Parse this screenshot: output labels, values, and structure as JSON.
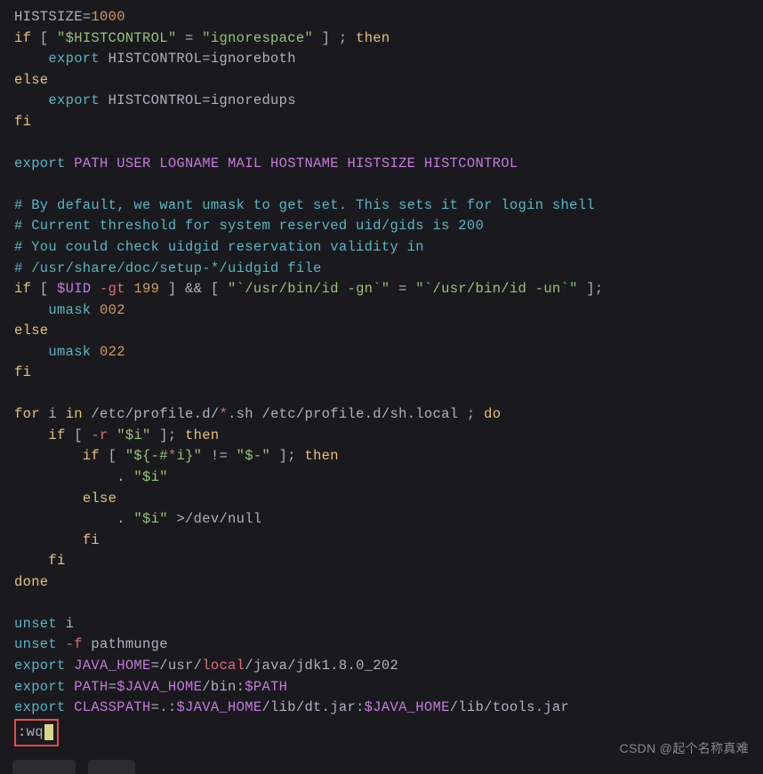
{
  "code": {
    "line1_var": "HISTSIZE",
    "line1_eq": "=",
    "line1_val": "1000",
    "line2_if": "if",
    "line2_br1": " [ ",
    "line2_str1": "\"$HISTCONTROL\"",
    "line2_eq": " = ",
    "line2_str2": "\"ignorespace\"",
    "line2_br2": " ] ; ",
    "line2_then": "then",
    "line3_pad": "    ",
    "line3_export": "export",
    "line3_rest": " HISTCONTROL=ignoreboth",
    "line4_else": "else",
    "line5_pad": "    ",
    "line5_export": "export",
    "line5_rest": " HISTCONTROL=ignoredups",
    "line6_fi": "fi",
    "line8_export": "export",
    "line8_vars": " PATH USER LOGNAME MAIL HOSTNAME HISTSIZE HISTCONTROL",
    "line10_c": "# By default, we want umask to get set. This sets it for login shell",
    "line11_c": "# Current threshold for system reserved uid/gids is 200",
    "line12_c": "# You could check uidgid reservation validity in",
    "line13_c": "# /usr/share/doc/setup-*/uidgid file",
    "line14_if": "if",
    "line14_br1": " [ ",
    "line14_uid": "$UID",
    "line14_gt": " -gt",
    "line14_num": " 199",
    "line14_mid": " ] && [ ",
    "line14_str1": "\"`/usr/bin/id -gn`\"",
    "line14_eq": " = ",
    "line14_str2": "\"`/usr/bin/id -un`\"",
    "line14_end": " ];",
    "line15_pad": "    ",
    "line15_umask": "umask",
    "line15_num": " 002",
    "line16_else": "else",
    "line17_pad": "    ",
    "line17_umask": "umask",
    "line17_num": " 022",
    "line18_fi": "fi",
    "line20_for": "for",
    "line20_i": " i ",
    "line20_in": "in",
    "line20_p1": " /etc/profile.d/",
    "line20_star": "*",
    "line20_p2": ".sh /etc/profile.d/sh.local",
    "line20_semi": " ; ",
    "line20_do": "do",
    "line21_pad": "    ",
    "line21_if": "if",
    "line21_br": " [ ",
    "line21_r": "-r",
    "line21_sp": " ",
    "line21_str": "\"$i\"",
    "line21_end": " ]; ",
    "line21_then": "then",
    "line22_pad": "        ",
    "line22_if": "if",
    "line22_br": " [ ",
    "line22_s1": "\"${-#",
    "line22_star": "*",
    "line22_s1b": "i}\"",
    "line22_neq": " != ",
    "line22_s2": "\"$-\"",
    "line22_end": " ]; ",
    "line22_then": "then",
    "line23_pad": "            . ",
    "line23_str": "\"$i\"",
    "line24_pad": "        ",
    "line24_else": "else",
    "line25_pad": "            . ",
    "line25_str": "\"$i\"",
    "line25_sp": " ",
    "line25_gt": ">",
    "line25_null": "/dev/null",
    "line26_pad": "        ",
    "line26_fi": "fi",
    "line27_pad": "    ",
    "line27_fi": "fi",
    "line28_done": "done",
    "line30_unset": "unset",
    "line30_i": " i",
    "line31_unset": "unset",
    "line31_f": " -f",
    "line31_pm": " pathmunge",
    "line32_export": "export",
    "line32_jh": " JAVA_HOME",
    "line32_eq": "=",
    "line32_usr": "/usr/",
    "line32_local": "local",
    "line32_rest": "/java/jdk1.8.0_202",
    "line33_export": "export",
    "line33_path": " PATH",
    "line33_eq": "=",
    "line33_jh": "$JAVA_HOME",
    "line33_bin": "/bin:",
    "line33_pathv": "$PATH",
    "line34_export": "export",
    "line34_cp": " CLASSPATH",
    "line34_eq": "=.:",
    "line34_jh1": "$JAVA_HOME",
    "line34_p1": "/lib/dt.jar:",
    "line34_jh2": "$JAVA_HOME",
    "line34_p2": "/lib/tools.jar"
  },
  "command": ":wq",
  "watermark": "CSDN @起个名称真难"
}
